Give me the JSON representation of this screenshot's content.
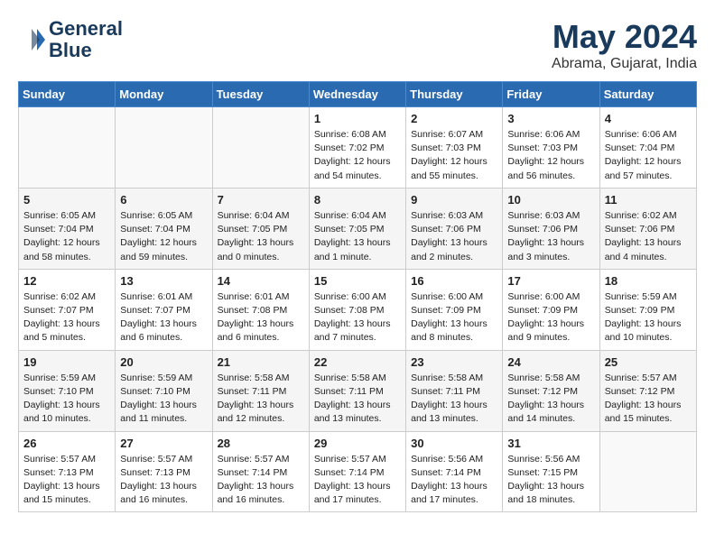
{
  "logo": {
    "line1": "General",
    "line2": "Blue"
  },
  "title": "May 2024",
  "subtitle": "Abrama, Gujarat, India",
  "days": [
    "Sunday",
    "Monday",
    "Tuesday",
    "Wednesday",
    "Thursday",
    "Friday",
    "Saturday"
  ],
  "weeks": [
    [
      {
        "day": "",
        "content": ""
      },
      {
        "day": "",
        "content": ""
      },
      {
        "day": "",
        "content": ""
      },
      {
        "day": "1",
        "content": "Sunrise: 6:08 AM\nSunset: 7:02 PM\nDaylight: 12 hours\nand 54 minutes."
      },
      {
        "day": "2",
        "content": "Sunrise: 6:07 AM\nSunset: 7:03 PM\nDaylight: 12 hours\nand 55 minutes."
      },
      {
        "day": "3",
        "content": "Sunrise: 6:06 AM\nSunset: 7:03 PM\nDaylight: 12 hours\nand 56 minutes."
      },
      {
        "day": "4",
        "content": "Sunrise: 6:06 AM\nSunset: 7:04 PM\nDaylight: 12 hours\nand 57 minutes."
      }
    ],
    [
      {
        "day": "5",
        "content": "Sunrise: 6:05 AM\nSunset: 7:04 PM\nDaylight: 12 hours\nand 58 minutes."
      },
      {
        "day": "6",
        "content": "Sunrise: 6:05 AM\nSunset: 7:04 PM\nDaylight: 12 hours\nand 59 minutes."
      },
      {
        "day": "7",
        "content": "Sunrise: 6:04 AM\nSunset: 7:05 PM\nDaylight: 13 hours\nand 0 minutes."
      },
      {
        "day": "8",
        "content": "Sunrise: 6:04 AM\nSunset: 7:05 PM\nDaylight: 13 hours\nand 1 minute."
      },
      {
        "day": "9",
        "content": "Sunrise: 6:03 AM\nSunset: 7:06 PM\nDaylight: 13 hours\nand 2 minutes."
      },
      {
        "day": "10",
        "content": "Sunrise: 6:03 AM\nSunset: 7:06 PM\nDaylight: 13 hours\nand 3 minutes."
      },
      {
        "day": "11",
        "content": "Sunrise: 6:02 AM\nSunset: 7:06 PM\nDaylight: 13 hours\nand 4 minutes."
      }
    ],
    [
      {
        "day": "12",
        "content": "Sunrise: 6:02 AM\nSunset: 7:07 PM\nDaylight: 13 hours\nand 5 minutes."
      },
      {
        "day": "13",
        "content": "Sunrise: 6:01 AM\nSunset: 7:07 PM\nDaylight: 13 hours\nand 6 minutes."
      },
      {
        "day": "14",
        "content": "Sunrise: 6:01 AM\nSunset: 7:08 PM\nDaylight: 13 hours\nand 6 minutes."
      },
      {
        "day": "15",
        "content": "Sunrise: 6:00 AM\nSunset: 7:08 PM\nDaylight: 13 hours\nand 7 minutes."
      },
      {
        "day": "16",
        "content": "Sunrise: 6:00 AM\nSunset: 7:09 PM\nDaylight: 13 hours\nand 8 minutes."
      },
      {
        "day": "17",
        "content": "Sunrise: 6:00 AM\nSunset: 7:09 PM\nDaylight: 13 hours\nand 9 minutes."
      },
      {
        "day": "18",
        "content": "Sunrise: 5:59 AM\nSunset: 7:09 PM\nDaylight: 13 hours\nand 10 minutes."
      }
    ],
    [
      {
        "day": "19",
        "content": "Sunrise: 5:59 AM\nSunset: 7:10 PM\nDaylight: 13 hours\nand 10 minutes."
      },
      {
        "day": "20",
        "content": "Sunrise: 5:59 AM\nSunset: 7:10 PM\nDaylight: 13 hours\nand 11 minutes."
      },
      {
        "day": "21",
        "content": "Sunrise: 5:58 AM\nSunset: 7:11 PM\nDaylight: 13 hours\nand 12 minutes."
      },
      {
        "day": "22",
        "content": "Sunrise: 5:58 AM\nSunset: 7:11 PM\nDaylight: 13 hours\nand 13 minutes."
      },
      {
        "day": "23",
        "content": "Sunrise: 5:58 AM\nSunset: 7:11 PM\nDaylight: 13 hours\nand 13 minutes."
      },
      {
        "day": "24",
        "content": "Sunrise: 5:58 AM\nSunset: 7:12 PM\nDaylight: 13 hours\nand 14 minutes."
      },
      {
        "day": "25",
        "content": "Sunrise: 5:57 AM\nSunset: 7:12 PM\nDaylight: 13 hours\nand 15 minutes."
      }
    ],
    [
      {
        "day": "26",
        "content": "Sunrise: 5:57 AM\nSunset: 7:13 PM\nDaylight: 13 hours\nand 15 minutes."
      },
      {
        "day": "27",
        "content": "Sunrise: 5:57 AM\nSunset: 7:13 PM\nDaylight: 13 hours\nand 16 minutes."
      },
      {
        "day": "28",
        "content": "Sunrise: 5:57 AM\nSunset: 7:14 PM\nDaylight: 13 hours\nand 16 minutes."
      },
      {
        "day": "29",
        "content": "Sunrise: 5:57 AM\nSunset: 7:14 PM\nDaylight: 13 hours\nand 17 minutes."
      },
      {
        "day": "30",
        "content": "Sunrise: 5:56 AM\nSunset: 7:14 PM\nDaylight: 13 hours\nand 17 minutes."
      },
      {
        "day": "31",
        "content": "Sunrise: 5:56 AM\nSunset: 7:15 PM\nDaylight: 13 hours\nand 18 minutes."
      },
      {
        "day": "",
        "content": ""
      }
    ]
  ]
}
